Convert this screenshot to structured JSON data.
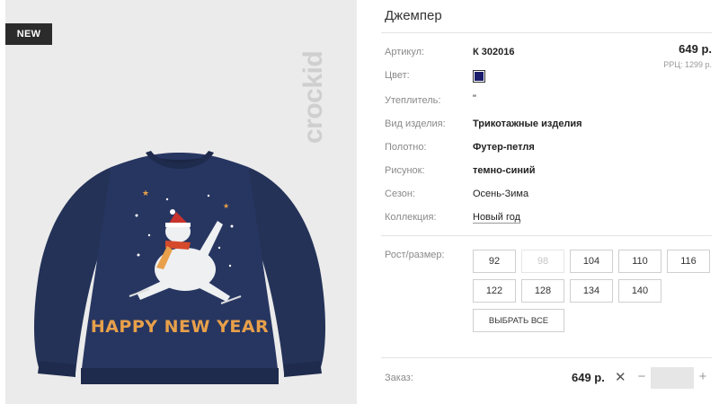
{
  "badge": "NEW",
  "brand": "crockid",
  "sweater_print": "HAPPY NEW YEAR",
  "product": {
    "title": "Джемпер",
    "price": "649 р.",
    "rrp": "РРЦ: 1299 р."
  },
  "specs": [
    {
      "label": "Артикул:",
      "value": "К 302016"
    },
    {
      "label": "Цвет:",
      "value": ""
    },
    {
      "label": "Утеплитель:",
      "value": "\""
    },
    {
      "label": "Вид изделия:",
      "value": "Трикотажные изделия"
    },
    {
      "label": "Полотно:",
      "value": "Футер-петля"
    },
    {
      "label": "Рисунок:",
      "value": "темно-синий"
    },
    {
      "label": "Сезон:",
      "value": "Осень-Зима"
    },
    {
      "label": "Коллекция:",
      "value": "Новый год"
    }
  ],
  "color_swatch": "#1a1c6b",
  "sizes": {
    "label": "Рост/размер:",
    "options": [
      "92",
      "98",
      "104",
      "110",
      "116",
      "122",
      "128",
      "134",
      "140"
    ],
    "disabled": [
      "98"
    ],
    "select_all": "ВЫБРАТЬ ВСЕ"
  },
  "order": {
    "label": "Заказ:",
    "price": "649 р.",
    "clear": "✕",
    "minus": "−",
    "plus": "+",
    "quantity": ""
  }
}
